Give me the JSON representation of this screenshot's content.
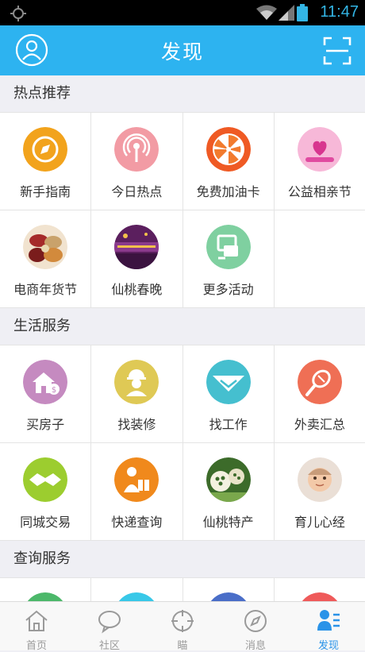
{
  "status_bar": {
    "time": "11:47",
    "icons": [
      "gps-icon",
      "wifi-icon",
      "signal-icon",
      "battery-icon"
    ]
  },
  "header": {
    "title": "发现",
    "left_icon": "user-icon",
    "right_icon": "scan-icon"
  },
  "sections": [
    {
      "title": "热点推荐",
      "items": [
        {
          "label": "新手指南",
          "icon": "compass-icon",
          "color": "#f2a31c"
        },
        {
          "label": "今日热点",
          "icon": "broadcast-icon",
          "color": "#f29ba4"
        },
        {
          "label": "免费加油卡",
          "icon": "orange-slice-icon",
          "color": "#ef5a24"
        },
        {
          "label": "公益相亲节",
          "icon": "heart-icon",
          "color": "#f59ac8"
        },
        {
          "label": "电商年货节",
          "icon": "food-photo-icon",
          "color": "#b84a3a"
        },
        {
          "label": "仙桃春晚",
          "icon": "gala-photo-icon",
          "color": "#6a2a6a"
        },
        {
          "label": "更多活动",
          "icon": "more-activity-icon",
          "color": "#7fd0a0"
        }
      ]
    },
    {
      "title": "生活服务",
      "items": [
        {
          "label": "买房子",
          "icon": "house-icon",
          "color": "#c58ac0"
        },
        {
          "label": "找装修",
          "icon": "worker-icon",
          "color": "#dfc955"
        },
        {
          "label": "找工作",
          "icon": "handshake-icon",
          "color": "#45bfcf"
        },
        {
          "label": "外卖汇总",
          "icon": "fork-knife-icon",
          "color": "#ef6f55"
        },
        {
          "label": "同城交易",
          "icon": "deal-icon",
          "color": "#9ccd2f"
        },
        {
          "label": "快递查询",
          "icon": "courier-icon",
          "color": "#f0891c"
        },
        {
          "label": "仙桃特产",
          "icon": "lotus-root-photo-icon",
          "color": "#7aa84c"
        },
        {
          "label": "育儿心经",
          "icon": "baby-photo-icon",
          "color": "#d8b59a"
        }
      ]
    },
    {
      "title": "查询服务",
      "items": [
        {
          "label": "",
          "icon": "query-icon-1",
          "color": "#4cb86a"
        },
        {
          "label": "",
          "icon": "query-icon-2",
          "color": "#38c8e8"
        },
        {
          "label": "",
          "icon": "query-icon-3",
          "color": "#4a6ec8"
        },
        {
          "label": "",
          "icon": "query-icon-4",
          "color": "#ef5a5a"
        }
      ]
    }
  ],
  "tabbar": {
    "tabs": [
      {
        "label": "首页",
        "icon": "home-icon"
      },
      {
        "label": "社区",
        "icon": "chat-bubble-icon"
      },
      {
        "label": "瞄",
        "icon": "crosshair-icon"
      },
      {
        "label": "消息",
        "icon": "compass-tab-icon"
      },
      {
        "label": "发现",
        "icon": "discover-icon",
        "active": true
      }
    ],
    "active_color": "#2a93e8",
    "inactive_color": "#9a9a9a"
  },
  "accent_color": "#2db3f0"
}
